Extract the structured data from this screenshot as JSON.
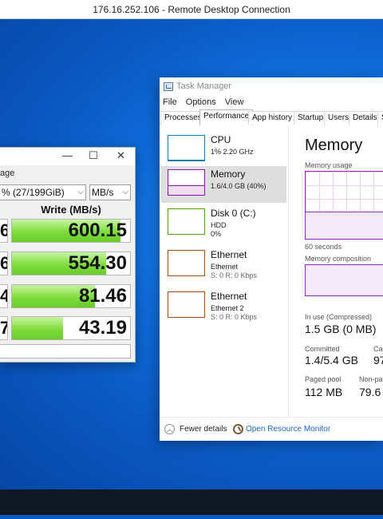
{
  "rdp": {
    "title": "176.16.252.106 - Remote Desktop Connection"
  },
  "cdm": {
    "partial_label": "age",
    "drive_select": "% (27/199GiB)",
    "unit_select": "MB/s",
    "write_header": "Write (MB/s)",
    "controls": {
      "minimize": "—",
      "maximize": "☐",
      "close": "✕"
    },
    "rows": [
      {
        "read_partial": "6",
        "write": "600.15",
        "fill": 0.92
      },
      {
        "read_partial": "6",
        "write": "554.30",
        "fill": 0.8
      },
      {
        "read_partial": "4",
        "write": "81.46",
        "fill": 0.7
      },
      {
        "read_partial": "7",
        "write": "43.19",
        "fill": 0.43
      }
    ]
  },
  "tm": {
    "title": "Task Manager",
    "menu": [
      "File",
      "Options",
      "View"
    ],
    "tabs": [
      "Processes",
      "Performance",
      "App history",
      "Startup",
      "Users",
      "Details",
      "S"
    ],
    "active_tab": "Performance",
    "resources": [
      {
        "name": "CPU",
        "sub1": "1% 2.20 GHz",
        "sub2": "",
        "color": "#117dbb",
        "level": 0.01
      },
      {
        "name": "Memory",
        "sub1": "1.6/4.0 GB (40%)",
        "sub2": "",
        "color": "#8b12ae",
        "level": 0.4,
        "selected": true
      },
      {
        "name": "Disk 0 (C:)",
        "sub1": "HDD",
        "sub2": "0%",
        "color": "#4da60c",
        "level": 0.0
      },
      {
        "name": "Ethernet",
        "sub1": "Ethernet",
        "sub2": "S: 0 R: 0 Kbps",
        "color": "#a74f01",
        "level": 0.0
      },
      {
        "name": "Ethernet",
        "sub1": "Ethernet 2",
        "sub2": "S: 0 R: 0 Kbps",
        "color": "#a74f01",
        "level": 0.0
      }
    ],
    "detail": {
      "title": "Memory",
      "usage_label": "Memory usage",
      "seconds_label": "60 seconds",
      "composition_label": "Memory composition",
      "usage_level": 0.4,
      "in_use_label": "In use (Compressed)",
      "in_use_value": "1.5 GB (0 MB)",
      "committed_label": "Committed",
      "committed_value": "1.4/5.4 GB",
      "cached_label": "Ca",
      "cached_value": "97",
      "paged_label": "Paged pool",
      "paged_value": "112 MB",
      "nonpaged_label": "Non-pa",
      "nonpaged_value": "79.6"
    },
    "footer": {
      "fewer": "Fewer details",
      "monitor": "Open Resource Monitor"
    }
  }
}
